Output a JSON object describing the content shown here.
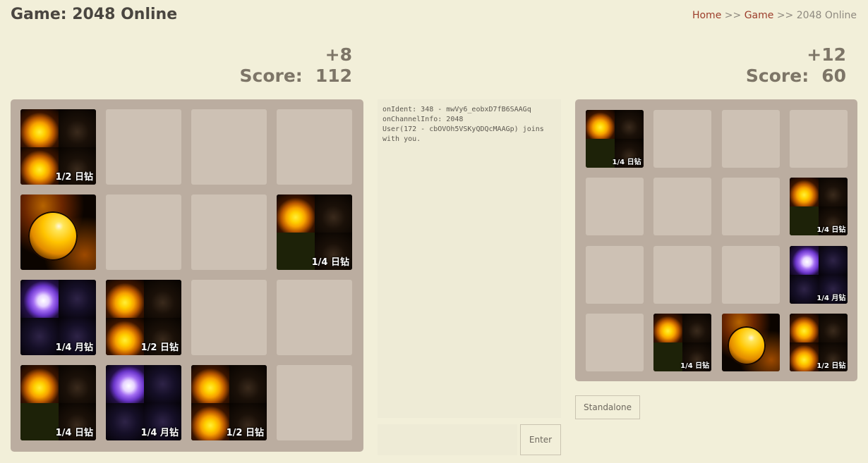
{
  "header": {
    "title": "Game: 2048 Online",
    "breadcrumb": {
      "home": "Home",
      "sep1": ">>",
      "game": "Game",
      "sep2": ">>",
      "current": "2048 Online"
    }
  },
  "players": {
    "left": {
      "delta": "+8",
      "score_label": "Score:",
      "score": "112"
    },
    "right": {
      "delta": "+12",
      "score_label": "Score:",
      "score": "60"
    }
  },
  "labels": {
    "sun_half": "1/2 日钻",
    "sun_quarter": "1/4 日钻",
    "moon_quarter": "1/4 月钻"
  },
  "board_left": {
    "rows": [
      [
        "sun_half",
        "",
        "",
        ""
      ],
      [
        "sun_full",
        "",
        "",
        "sun_quarter"
      ],
      [
        "moon_quarter",
        "sun_half",
        "",
        ""
      ],
      [
        "sun_quarter",
        "moon_quarter",
        "sun_half",
        ""
      ]
    ]
  },
  "board_right": {
    "rows": [
      [
        "sun_quarter",
        "",
        "",
        ""
      ],
      [
        "",
        "",
        "",
        "sun_quarter"
      ],
      [
        "",
        "",
        "",
        "moon_quarter"
      ],
      [
        "",
        "sun_quarter",
        "sun_full",
        "sun_half"
      ]
    ]
  },
  "chat": {
    "lines": [
      "onIdent: 348 - mwVy6_eobxD7fB6SAAGq",
      "onChannelInfo: 2048",
      "User(172 - cbOVOh5VSKyQDQcMAAGp) joins\nwith you."
    ],
    "input_value": "",
    "enter_label": "Enter"
  },
  "buttons": {
    "standalone_label": "Standalone"
  },
  "colors": {
    "background": "#f2efd9",
    "board": "#bbada0",
    "cell": "#cdc1b4",
    "link": "#9c3d2b",
    "score_text": "#7d7567"
  },
  "icons": {
    "sun_tile": "sun-diamond-icon",
    "moon_tile": "moon-diamond-icon"
  }
}
